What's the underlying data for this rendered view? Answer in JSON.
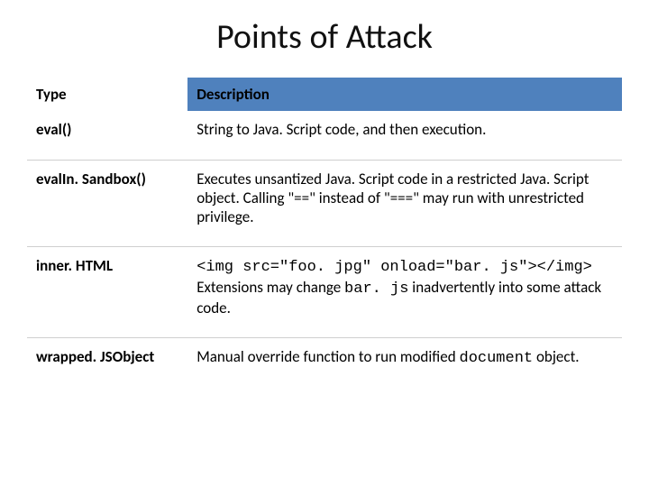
{
  "title": "Points of Attack",
  "headers": {
    "type": "Type",
    "description": "Description"
  },
  "rows": [
    {
      "type": "eval()",
      "desc": "String to Java. Script code, and then execution."
    },
    {
      "type": "evalIn. Sandbox()",
      "desc": "Executes unsantized Java. Script code in a restricted Java. Script object.  Calling \"==\" instead of \"===\" may run with unrestricted privilege."
    },
    {
      "type": "inner. HTML",
      "code": "<img src=\"foo. jpg\" onload=\"bar. js\"></img>",
      "desc_after_pre": "Extensions may change ",
      "code2": "bar. js",
      "desc_after": " inadvertently into some attack code."
    },
    {
      "type": "wrapped. JSObject",
      "desc_pre": "Manual override function to run modified ",
      "code": "document",
      "desc_post": " object."
    }
  ]
}
